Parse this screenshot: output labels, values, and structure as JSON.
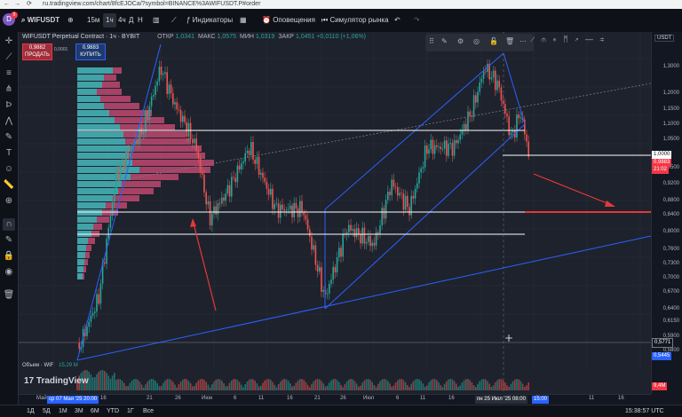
{
  "browser": {
    "url": "ru.tradingview.com/chart/8fcEJOCa/?symbol=BINANCE%3AWIFUSDT.P#order"
  },
  "toolbar": {
    "symbol": "WIFUSDT",
    "intervals": [
      "15м",
      "1ч",
      "4ч",
      "Д",
      "Н"
    ],
    "indicators_label": "Индикаторы",
    "alert_label": "Оповещения",
    "replay_label": "Симулятор рынка",
    "avatar_letter": "D",
    "notification_count": "9"
  },
  "legend": {
    "title": "WIFUSDT Perpetual Contract · 1ч · BYBIT",
    "ohlc": [
      {
        "k": "ОТКР",
        "v": "1,0341"
      },
      {
        "k": "МАКС",
        "v": "1,0575"
      },
      {
        "k": "МИН",
        "v": "1,0319"
      },
      {
        "k": "ЗАКР",
        "v": "1,0451"
      },
      {
        "k": "",
        "v": "+0,0110 (+1,06%)"
      }
    ],
    "sell_price": "0,9882",
    "sell_label": "ПРОДАТЬ",
    "spread": "0,0001",
    "buy_price": "0,9883",
    "buy_label": "КУПИТЬ",
    "volume_label": "Объем · WIF",
    "volume_value": "15,29 М"
  },
  "price_axis": {
    "currency": "USDT",
    "labels": [
      "1,3000",
      "1,2000",
      "1,1500",
      "1,1000",
      "1,0500",
      "0,9500",
      "0,9200",
      "0,8800",
      "0,8400",
      "0,8000",
      "0,7600",
      "0,7300",
      "0,7000",
      "0,6700",
      "0,6400",
      "0,6150",
      "0,5900",
      "0,5800"
    ],
    "badge_current": "1,0000",
    "badge_last": "0,9883",
    "badge_countdown": "21:02",
    "badge_low": "0,5771",
    "badge_blue": "0,5445",
    "volume_badge": "9,4М"
  },
  "time_axis": {
    "labels": [
      "Май",
      "16",
      "21",
      "26",
      "Июн",
      "6",
      "11",
      "16",
      "21",
      "26",
      "Июл",
      "6",
      "11",
      "16",
      "6",
      "11",
      "16"
    ],
    "start_badge": "ср 07 Мая '25   20:00",
    "cursor_badge": "пн 25 Июл '25   08:00",
    "right_badge": "15:00"
  },
  "bottombar": {
    "ranges": [
      "1Д",
      "5Д",
      "1М",
      "3М",
      "6М",
      "YTD",
      "1Г",
      "Все"
    ],
    "clock": "15:38:57 UTC"
  },
  "colors": {
    "bull": "#26a69a",
    "bear": "#ef5350",
    "trendline": "#2962ff",
    "level": "#ffffff",
    "arrow": "#e53935",
    "vp_up": "#4ecdd2",
    "vp_down": "#e0507e"
  },
  "chart_data": {
    "type": "candlestick",
    "price_levels": [
      1.0,
      0.84,
      0.8
    ],
    "current_price": 0.9883,
    "markers": [
      "long-trendline-channel",
      "volume-profile-left",
      "red-arrows"
    ]
  }
}
